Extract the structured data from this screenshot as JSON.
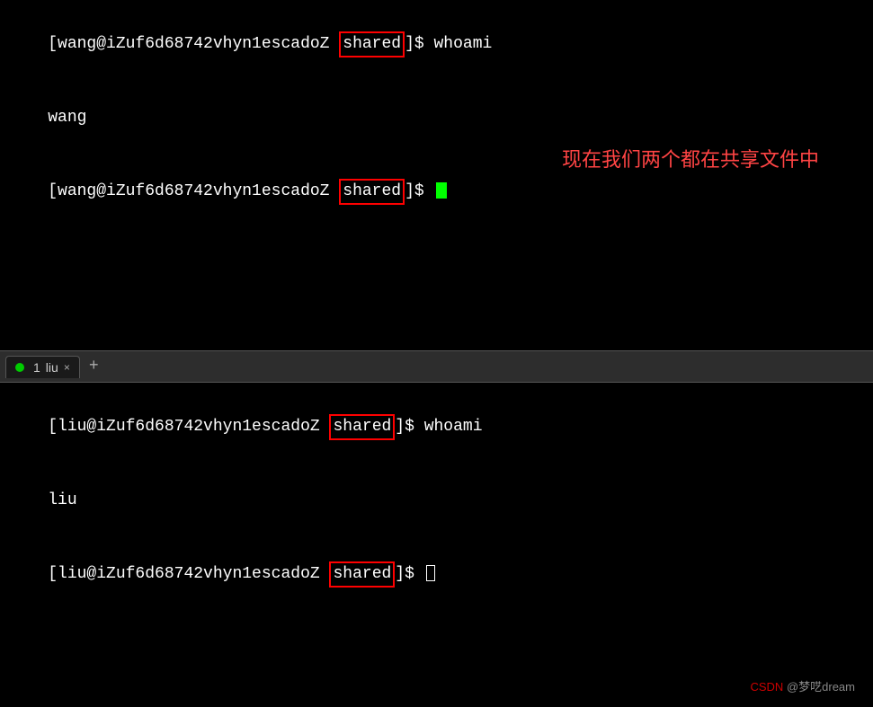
{
  "top_terminal": {
    "lines": [
      {
        "prefix": "[wang@iZuf6d68742vhyn1escadoZ ",
        "dir": "shared",
        "suffix": "]$ whoami"
      },
      {
        "plain": "wang"
      },
      {
        "prefix": "[wang@iZuf6d68742vhyn1escadoZ ",
        "dir": "shared",
        "suffix": "]$ ",
        "cursor": "green-block"
      }
    ],
    "annotation": "现在我们两个都在共享文件中"
  },
  "tab_bar": {
    "tab_number": "1",
    "tab_name": "liu",
    "close_label": "×",
    "add_label": "+"
  },
  "bottom_terminal": {
    "lines": [
      {
        "prefix": "[liu@iZuf6d68742vhyn1escadoZ ",
        "dir": "shared",
        "suffix": "]$ whoami"
      },
      {
        "plain": "liu"
      },
      {
        "prefix": "[liu@iZuf6d68742vhyn1escadoZ ",
        "dir": "shared",
        "suffix": "]$ ",
        "cursor": "hollow"
      }
    ]
  },
  "watermark": {
    "site": "CSDN",
    "handle": " @梦呓dream"
  }
}
